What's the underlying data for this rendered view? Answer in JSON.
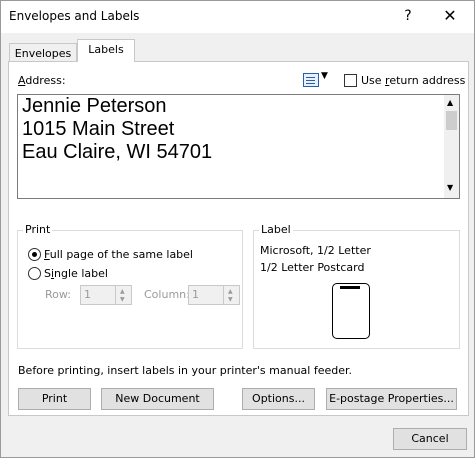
{
  "window": {
    "title": "Envelopes and Labels",
    "help_glyph": "?",
    "close_glyph": "✕"
  },
  "tabs": [
    {
      "label": "Envelopes",
      "active": false
    },
    {
      "label": "Labels",
      "active": true
    }
  ],
  "address": {
    "label": "Address:",
    "label_underline": "A",
    "label_rest": "ddress:",
    "book_icon": "address-book-icon",
    "use_return_label": "Use return address",
    "use_return_underline": "r",
    "use_return_checked": false,
    "value": "Jennie Peterson\n1015 Main Street\nEau Claire, WI 54701"
  },
  "print": {
    "title": "Print",
    "full_page": {
      "label": "Full page of the same label",
      "underline": "F",
      "rest": "ull page of the same label",
      "checked": true
    },
    "single_label": {
      "label": "Single label",
      "pre": "S",
      "underline": "i",
      "rest": "ngle label",
      "checked": false
    },
    "row": {
      "label": "Row:",
      "value": "1"
    },
    "column": {
      "label": "Column:",
      "value": "1"
    }
  },
  "label": {
    "title": "Label",
    "vendor": "Microsoft, 1/2 Letter",
    "product": "1/2 Letter Postcard"
  },
  "note": "Before printing, insert labels in your printer's manual feeder.",
  "buttons": {
    "print": "Print",
    "new_document": "New Document",
    "options": "Options...",
    "epostage": "E-postage Properties...",
    "cancel": "Cancel"
  }
}
